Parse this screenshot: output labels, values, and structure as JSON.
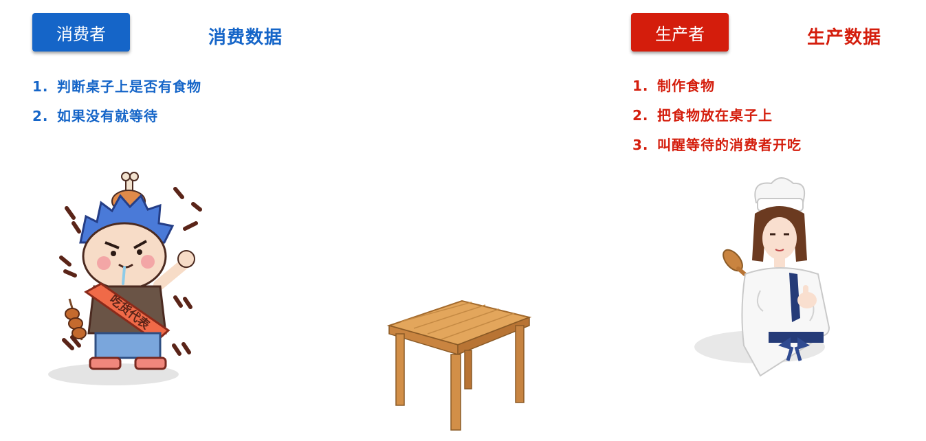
{
  "consumer": {
    "button_label": "消费者",
    "section_title": "消费数据",
    "steps": [
      {
        "num": "1.",
        "text": "判断桌子上是否有食物"
      },
      {
        "num": "2.",
        "text": "如果没有就等待"
      }
    ],
    "sash_text": "吃货代表",
    "color": "#1565c8"
  },
  "producer": {
    "button_label": "生产者",
    "section_title": "生产数据",
    "steps": [
      {
        "num": "1.",
        "text": "制作食物"
      },
      {
        "num": "2.",
        "text": "把食物放在桌子上"
      },
      {
        "num": "3.",
        "text": "叫醒等待的消费者开吃"
      }
    ],
    "color": "#d41d0c"
  },
  "illustrations": {
    "consumer": "foodie-character-icon",
    "table": "wooden-table-icon",
    "producer": "chef-character-icon"
  }
}
